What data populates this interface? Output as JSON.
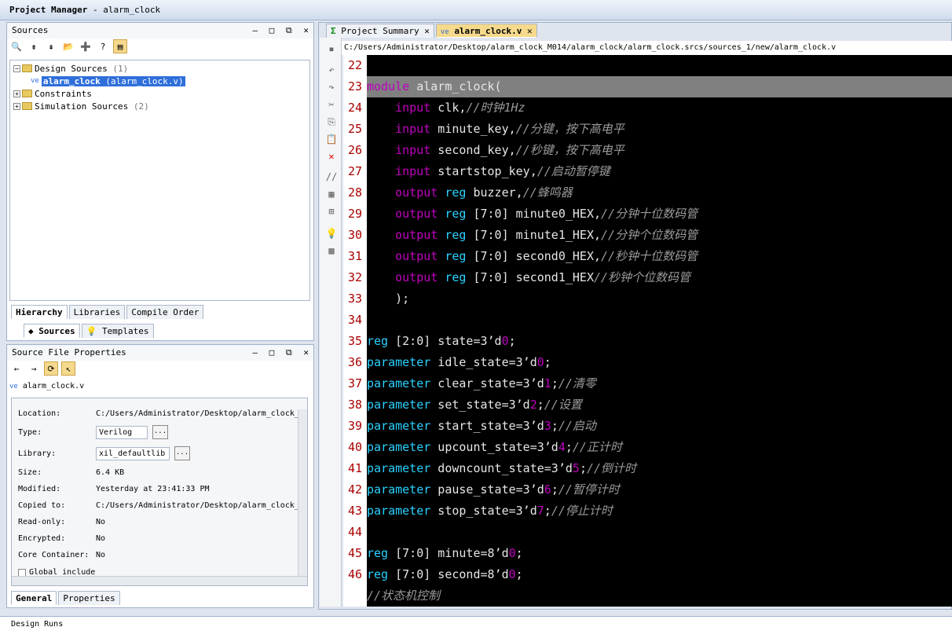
{
  "window": {
    "title_bold": "Project Manager",
    "title_rest": "- alarm_clock"
  },
  "sources_panel": {
    "title": "Sources",
    "controls": [
      "—",
      "□",
      "⧉",
      "✕"
    ],
    "tree": [
      {
        "label": "Design Sources",
        "count": "(1)"
      },
      {
        "label": "alarm_clock",
        "detail": "(alarm_clock.v)"
      },
      {
        "label": "Constraints"
      },
      {
        "label": "Simulation Sources",
        "count": "(2)"
      }
    ],
    "view_tabs": [
      "Hierarchy",
      "Libraries",
      "Compile Order"
    ],
    "bottom_tabs": [
      "Sources",
      "Templates"
    ]
  },
  "props_panel": {
    "title": "Source File Properties",
    "controls": [
      "—",
      "□",
      "⧉",
      "✕"
    ],
    "file": "alarm_clock.v",
    "rows": [
      {
        "k": "Location:",
        "v": "C:/Users/Administrator/Desktop/alarm_clock_"
      },
      {
        "k": "Type:",
        "v": "Verilog"
      },
      {
        "k": "Library:",
        "v": "xil_defaultlib"
      },
      {
        "k": "Size:",
        "v": "6.4 KB"
      },
      {
        "k": "Modified:",
        "v": "Yesterday at 23:41:33 PM"
      },
      {
        "k": "Copied to:",
        "v": "C:/Users/Administrator/Desktop/alarm_clock_"
      },
      {
        "k": "Read-only:",
        "v": "No"
      },
      {
        "k": "Encrypted:",
        "v": "No"
      },
      {
        "k": "Core Container:",
        "v": "No"
      },
      {
        "k": "Global include",
        "v": ""
      }
    ],
    "tabs": [
      "General",
      "Properties"
    ]
  },
  "editor": {
    "tabs": [
      "Project Summary",
      "alarm_clock.v"
    ],
    "path": "C:/Users/Administrator/Desktop/alarm_clock_M014/alarm_clock/alarm_clock.srcs/sources_1/new/alarm_clock.v"
  },
  "design_runs": {
    "title": "Design Runs"
  },
  "colors": {
    "keyword": "#c000c0",
    "type_keyword": "#2ad2ff",
    "comment": "#9a9a9a",
    "line_number": "#aa0000",
    "selection": "#2f6fdb"
  }
}
